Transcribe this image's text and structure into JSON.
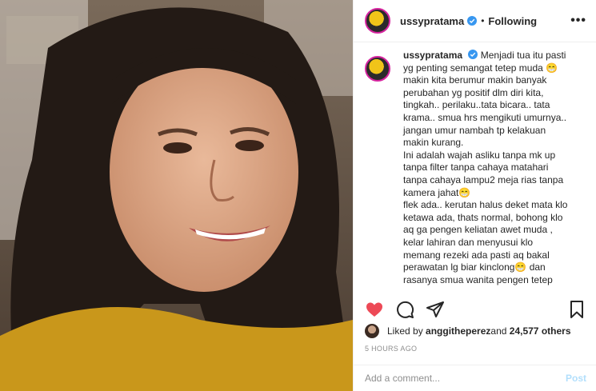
{
  "post": {
    "username": "ussypratama",
    "follow_label": "Following",
    "more_label": "•••"
  },
  "caption": {
    "username": "ussypratama",
    "lines": [
      "Menjadi tua itu pasti",
      "yg penting semangat tetep muda 😁",
      "makin kita berumur makin banyak",
      "perubahan yg positif dlm diri kita,",
      "tingkah.. perilaku..tata bicara.. tata",
      "krama.. smua hrs mengikuti umurnya..",
      "jangan umur nambah tp kelakuan",
      "makin kurang.",
      "Ini adalah wajah asliku tanpa mk up",
      "tanpa filter tanpa cahaya matahari",
      "tanpa cahaya lampu2 meja rias tanpa",
      "kamera jahat😁",
      "flek ada.. kerutan halus deket mata klo",
      "ketawa ada, thats normal, bohong klo",
      "aq ga pengen keliatan awet muda ,",
      "kelar lahiran dan menyusui klo",
      "memang rezeki ada pasti aq bakal",
      "perawatan lg biar kinclong😁 dan",
      "rasanya smua wanita pengen tetep"
    ]
  },
  "likes": {
    "prefix": "Liked by ",
    "user": "anggitheperez",
    "middle": " and ",
    "count": "24,577 others"
  },
  "timestamp": "5 HOURS AGO",
  "comment": {
    "placeholder": "Add a comment...",
    "post_label": "Post"
  },
  "colors": {
    "like_red": "#ed4956",
    "verified_blue": "#3897f0",
    "post_disabled": "#b2dffc"
  }
}
